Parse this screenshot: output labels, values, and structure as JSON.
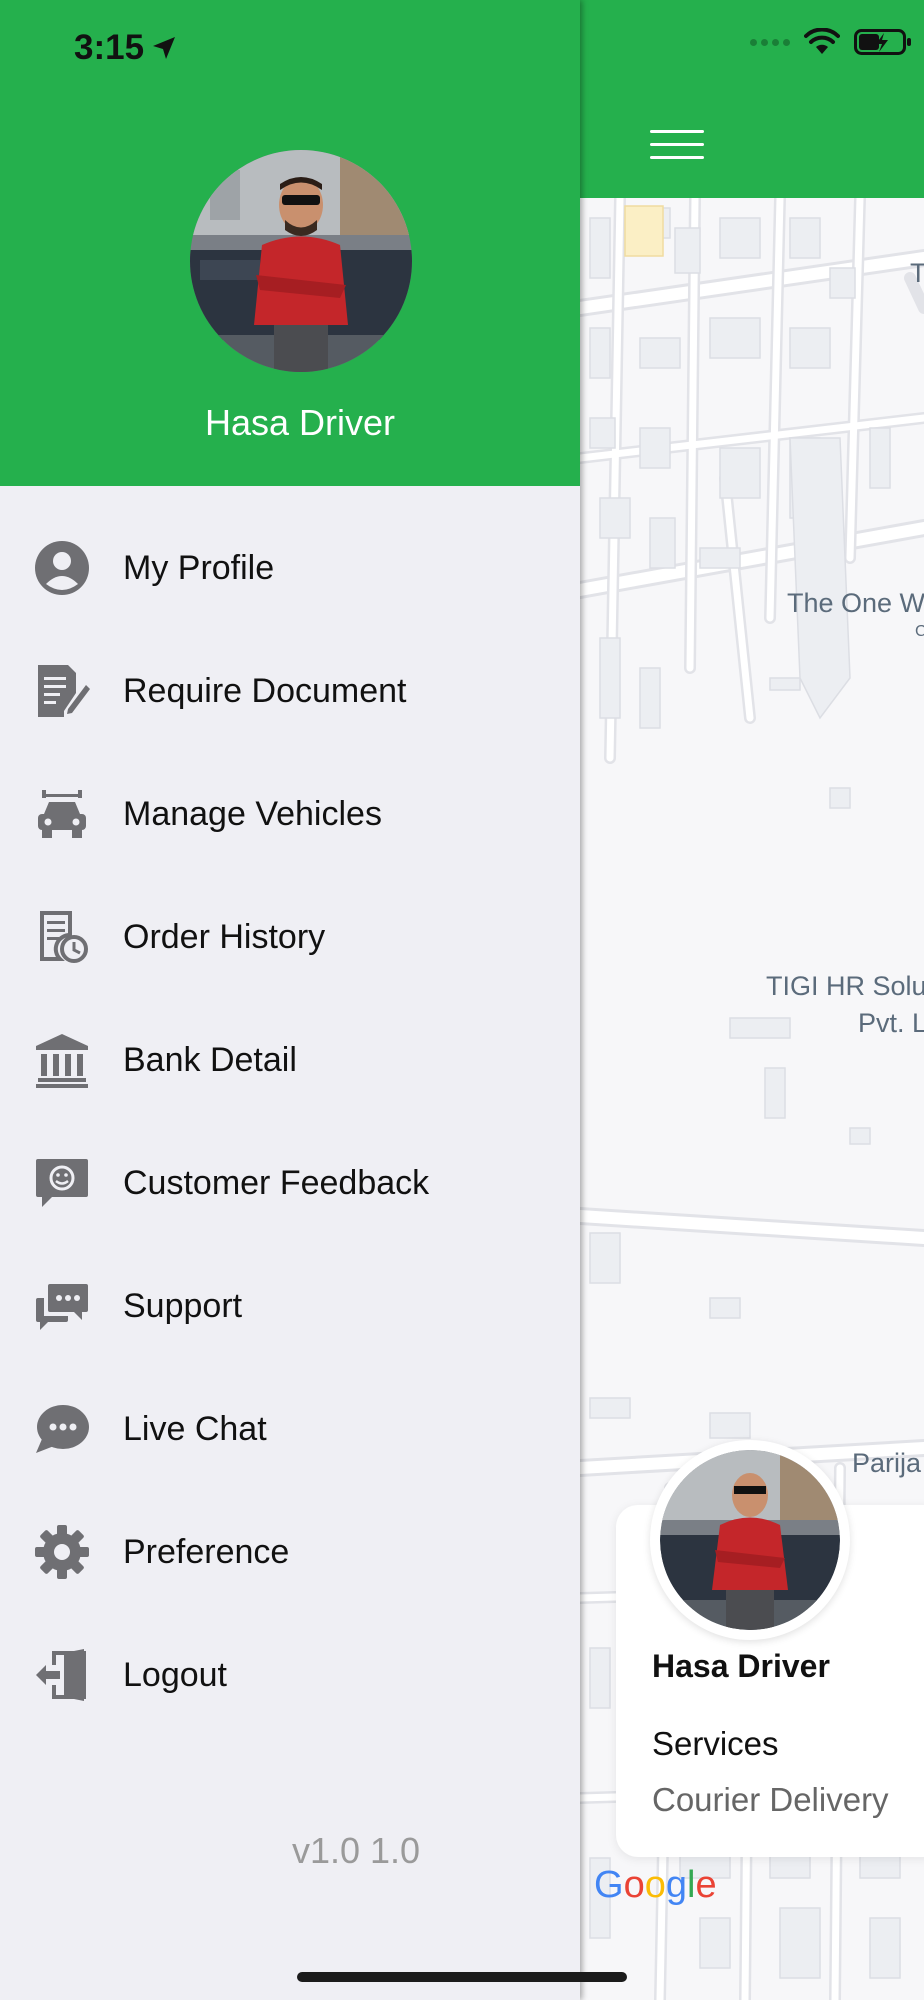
{
  "status_bar": {
    "time": "3:15",
    "location_icon": "location-arrow-icon",
    "wifi_icon": "wifi-icon",
    "battery_icon": "battery-charging-icon"
  },
  "drawer": {
    "user_name": "Hasa Driver",
    "header_color": "#25b04d",
    "items": [
      {
        "label": "My Profile",
        "icon": "person-icon"
      },
      {
        "label": "Require Document",
        "icon": "document-edit-icon"
      },
      {
        "label": "Manage Vehicles",
        "icon": "car-icon"
      },
      {
        "label": "Order History",
        "icon": "receipt-clock-icon"
      },
      {
        "label": "Bank Detail",
        "icon": "bank-icon"
      },
      {
        "label": "Customer Feedback",
        "icon": "feedback-smile-icon"
      },
      {
        "label": "Support",
        "icon": "chat-dots-icon"
      },
      {
        "label": "Live Chat",
        "icon": "chat-bubble-icon"
      },
      {
        "label": "Preference",
        "icon": "gear-icon"
      },
      {
        "label": "Logout",
        "icon": "logout-icon"
      }
    ],
    "version": "v1.0 1.0"
  },
  "map": {
    "menu_icon": "hamburger-icon",
    "labels": {
      "top_letter": "T",
      "place_1": "The One W",
      "place_1_sub": "C",
      "place_2_line1": "TIGI HR Solu",
      "place_2_line2": "Pvt. L",
      "place_3": "Parija"
    },
    "attribution": "Google"
  },
  "driver_card": {
    "name": "Hasa Driver",
    "services_title": "Services",
    "services_value": "Courier Delivery"
  }
}
